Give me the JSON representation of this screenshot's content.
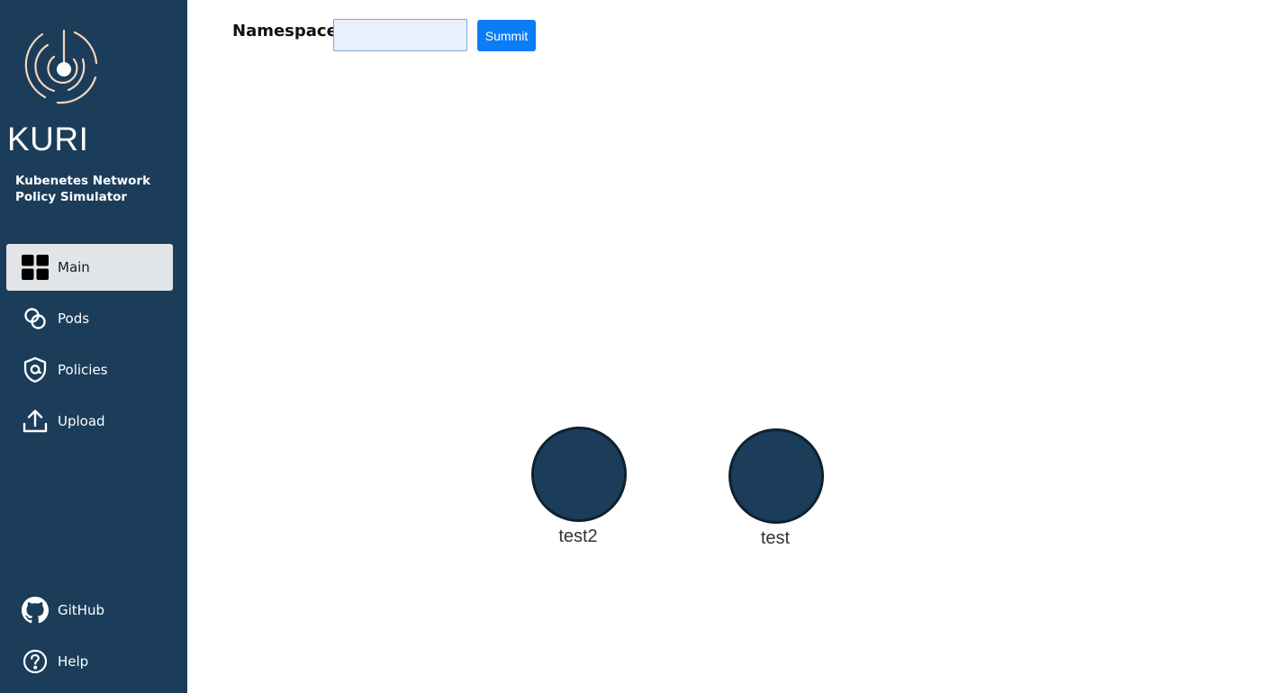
{
  "app": {
    "brand": "KURI",
    "subtitle": "Kubenetes Network Policy Simulator"
  },
  "sidebar": {
    "items": [
      {
        "label": "Main",
        "icon": "grid-icon",
        "active": true
      },
      {
        "label": "Pods",
        "icon": "pods-icon",
        "active": false
      },
      {
        "label": "Policies",
        "icon": "shield-icon",
        "active": false
      },
      {
        "label": "Upload",
        "icon": "upload-icon",
        "active": false
      }
    ],
    "footer": [
      {
        "label": "GitHub",
        "icon": "github-icon"
      },
      {
        "label": "Help",
        "icon": "help-icon"
      }
    ]
  },
  "namespace": {
    "label": "Namespace",
    "value": "",
    "placeholder": "",
    "button_label": "Summit"
  },
  "graph": {
    "nodes": [
      {
        "label": "test2"
      },
      {
        "label": "test"
      }
    ]
  },
  "colors": {
    "sidebar_bg": "#1b3d5a",
    "active_item_bg": "#e1e5e8",
    "accent": "#0a7df7",
    "node_fill": "#1b3d5a",
    "logo_stroke": "#f0c9a8"
  }
}
